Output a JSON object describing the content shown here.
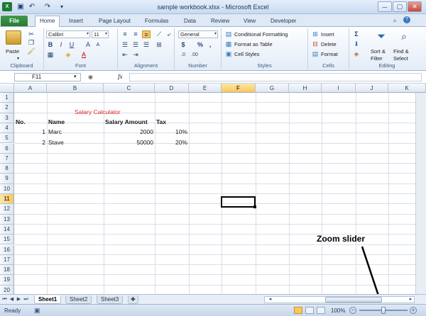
{
  "window": {
    "title": "sample workbook.xlsx - Microsoft Excel"
  },
  "tabs": {
    "file": "File",
    "items": [
      "Home",
      "Insert",
      "Page Layout",
      "Formulas",
      "Data",
      "Review",
      "View",
      "Developer"
    ],
    "active": "Home"
  },
  "ribbon": {
    "clipboard": {
      "label": "Clipboard",
      "paste": "Paste"
    },
    "font": {
      "label": "Font",
      "name": "Calibri",
      "size": "11"
    },
    "alignment": {
      "label": "Alignment"
    },
    "number": {
      "label": "Number",
      "format": "General",
      "currency": "$",
      "percent": "%",
      "comma": ","
    },
    "styles": {
      "label": "Styles",
      "conditional": "Conditional Formatting",
      "table": "Format as Table",
      "cell_styles": "Cell Styles"
    },
    "cells": {
      "label": "Cells",
      "insert": "Insert",
      "delete": "Delete",
      "format": "Format"
    },
    "editing": {
      "label": "Editing",
      "sort1": "Sort &",
      "sort2": "Filter",
      "find1": "Find &",
      "find2": "Select"
    }
  },
  "formula_bar": {
    "name_box": "F11",
    "fx": "fx",
    "formula": ""
  },
  "grid": {
    "columns": [
      "A",
      "B",
      "C",
      "D",
      "E",
      "F",
      "G",
      "H",
      "I",
      "J",
      "K"
    ],
    "rows": [
      "1",
      "2",
      "3",
      "4",
      "5",
      "6",
      "7",
      "8",
      "9",
      "10",
      "11",
      "12",
      "13",
      "14",
      "15",
      "16",
      "17",
      "18",
      "19",
      "20"
    ],
    "selected_cell": "F11",
    "title": "Salary Calculator",
    "headers": {
      "a": "No.",
      "b": "Name",
      "c": "Salary Amount",
      "d": "Tax"
    },
    "row4": {
      "a": "1",
      "b": "Marc",
      "c": "2000",
      "d": "10%"
    },
    "row5": {
      "a": "2",
      "b": "Stave",
      "c": "50000",
      "d": "20%"
    }
  },
  "sheets": [
    "Sheet1",
    "Sheet2",
    "Sheet3"
  ],
  "status": {
    "ready": "Ready",
    "zoom": "100%",
    "zoom_level": 100
  },
  "annotation": "Zoom slider",
  "colors": {
    "title_red": "#e8262b",
    "selection": "#000000",
    "file_green": "#2f8a3b"
  }
}
